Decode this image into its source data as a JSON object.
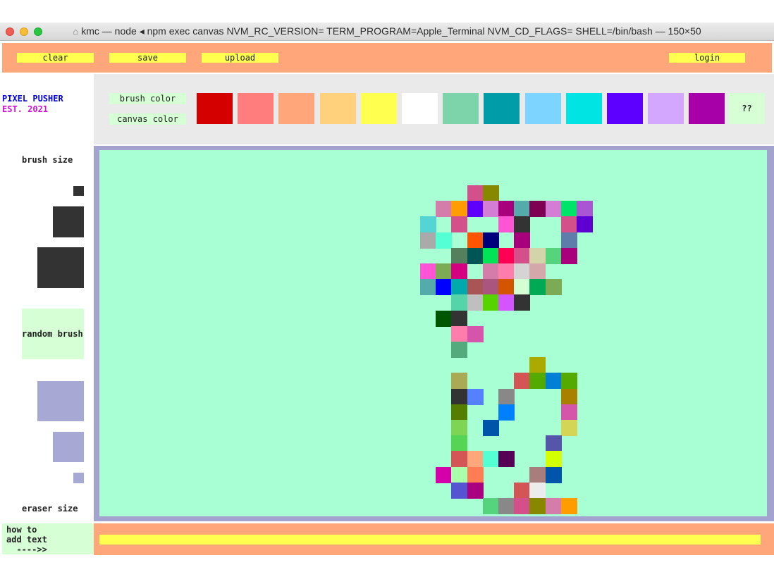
{
  "window": {
    "title": "kmc — node ◂ npm exec canvas NVM_RC_VERSION= TERM_PROGRAM=Apple_Terminal NVM_CD_FLAGS= SHELL=/bin/bash — 150×50",
    "home_icon": "home-icon",
    "traffic_lights": [
      "#ee5c54",
      "#f8bc33",
      "#27c840"
    ]
  },
  "toolbar": {
    "clear_label": "clear",
    "save_label": "save",
    "upload_label": "upload",
    "login_label": "login"
  },
  "logo": {
    "line1": "PIXEL PUSHER",
    "line2": "EST. 2021"
  },
  "color_mode": {
    "brush_label": "brush color",
    "canvas_label": "canvas color"
  },
  "palette": {
    "colors": [
      "#d40000",
      "#ff7d7d",
      "#ffa77a",
      "#ffd17d",
      "#ffff4f",
      "#ffffff",
      "#7dd4aa",
      "#009ca8",
      "#7dd4ff",
      "#00e4e4",
      "#5e00ff",
      "#d4a7ff",
      "#a800a8"
    ],
    "random_label": "??"
  },
  "sidebar": {
    "brush_size_label": "brush size",
    "random_brush_label": "random brush",
    "eraser_size_label": "eraser size",
    "brush_color": "#333333",
    "eraser_color": "#a8a8d4"
  },
  "canvas": {
    "background": "#a8ffd4",
    "pixel_colors": [
      "#d4508a",
      "#888800",
      "#d47daa",
      "#ff9c00",
      "#5e00ff",
      "#d47dd4",
      "#a8007d",
      "#55aaaa",
      "#7d0055",
      "#d47dd4",
      "#00e46a",
      "#aa55d4",
      "#55d4d4",
      "#d4508a",
      "#ff55d4",
      "#333333",
      "#d4508a",
      "#5e00d4",
      "#aaaaaa",
      "#55ffd4",
      "#ff5500",
      "#00007d",
      "#a8007d",
      "#5e7daa",
      "#55805e",
      "#005555",
      "#00e455",
      "#ff0055",
      "#d4508a",
      "#d4d4aa",
      "#55d47d",
      "#a8007d",
      "#ff55d4",
      "#7daa55",
      "#d40080",
      "#d47daa",
      "#ff7daa",
      "#d4d4d4",
      "#d4a7aa",
      "#55aaaa",
      "#0000ff",
      "#00aaaa",
      "#aa5555",
      "#aa5580",
      "#d45500",
      "#d4ffd4",
      "#00aa55",
      "#7daa55",
      "#55d4aa",
      "#bfbfbf",
      "#55d400",
      "#d455ff",
      "#333333",
      "#005500",
      "#333333",
      "#ff7daa",
      "#d455aa",
      "#55aa7d",
      "#aaaa00",
      "#aaaa55",
      "#d45555",
      "#55aa00",
      "#0080d4",
      "#55aa00",
      "#333333",
      "#5580ff",
      "#888888",
      "#aa8000",
      "#557d00",
      "#0080ff",
      "#d455aa",
      "#7dd455",
      "#0055aa",
      "#d4d455",
      "#55d455",
      "#5555aa",
      "#d45555",
      "#ffa77a",
      "#55ffd4",
      "#550055",
      "#d4ff00",
      "#d400aa",
      "#aaffaa",
      "#ff7d55",
      "#aa7d7d",
      "#0055aa",
      "#5555d4",
      "#aa0080",
      "#d45555",
      "#ececec",
      "#55d47d",
      "#888888"
    ]
  },
  "help": {
    "how_to_text": "how to\nadd text\n  ---->>"
  },
  "text_input": {
    "value": "",
    "placeholder": ""
  }
}
